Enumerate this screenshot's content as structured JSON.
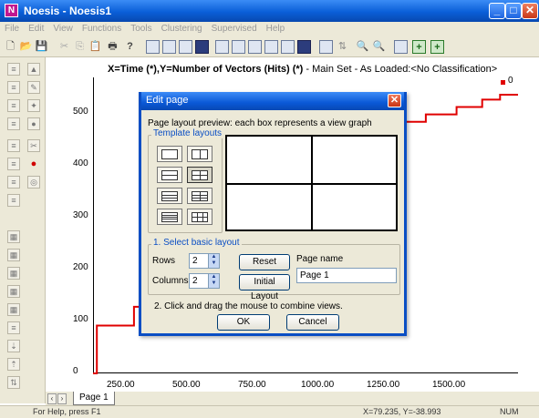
{
  "window": {
    "title": "Noesis - Noesis1",
    "app_icon": "N"
  },
  "menu": [
    "File",
    "Edit",
    "View",
    "Functions",
    "Tools",
    "Clustering",
    "Supervised",
    "Help"
  ],
  "plot": {
    "title_bold": "X=Time (*),Y=Number of Vectors (Hits) (*)",
    "title_rest": " - Main Set - As Loaded:<No Classification>",
    "legend_label": "0",
    "series_color": "#e00000"
  },
  "chart_data": {
    "type": "line",
    "title": "X=Time (*),Y=Number of Vectors (Hits) (*) - Main Set - As Loaded:<No Classification>",
    "x_ticks": [
      "250.00",
      "500.00",
      "750.00",
      "1000.00",
      "1250.00",
      "1500.00"
    ],
    "y_ticks": [
      "0",
      "100",
      "200",
      "300",
      "400",
      "500"
    ],
    "xlim": [
      0,
      1660
    ],
    "ylim": [
      0,
      600
    ],
    "series": [
      {
        "name": "0",
        "step": true,
        "x": [
          0,
          15,
          15,
          160,
          160,
          1200,
          1200,
          1300,
          1300,
          1420,
          1420,
          1520,
          1520,
          1590,
          1590,
          1660
        ],
        "y": [
          0,
          0,
          97,
          97,
          135,
          135,
          510,
          510,
          525,
          525,
          540,
          540,
          555,
          555,
          565,
          565
        ]
      }
    ]
  },
  "tabs": {
    "page_tab": "Page 1",
    "prev_arrow": "‹",
    "next_arrow": "›"
  },
  "status": {
    "help": "For Help, press F1",
    "coords": "X=79.235, Y=-38.993",
    "num": "NUM"
  },
  "dialog": {
    "title": "Edit page",
    "description": "Page layout preview: each box represents a view graph",
    "template_group_label": "Template layouts",
    "basic_group_label": "1. Select basic layout",
    "rows_label": "Rows",
    "rows_value": "2",
    "columns_label": "Columns",
    "columns_value": "2",
    "reset_label": "Reset",
    "initial_layout_label": "Initial Layout",
    "page_name_label": "Page name",
    "page_name_value": "Page 1",
    "instruction": "2. Click and drag the mouse to combine views.",
    "ok_label": "OK",
    "cancel_label": "Cancel"
  }
}
